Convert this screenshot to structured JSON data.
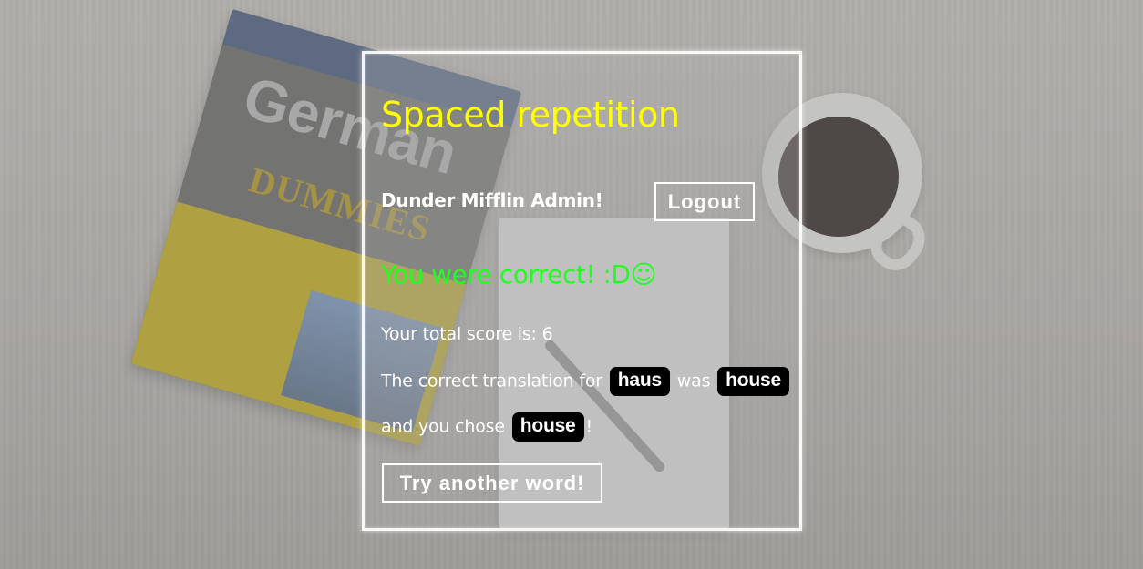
{
  "app": {
    "title": "Spaced repetition"
  },
  "header": {
    "user_greeting": "Dunder Mifflin Admin!",
    "logout_label": "Logout"
  },
  "result": {
    "feedback": "You were correct! :D☺",
    "score_line": "Your total score is: 6",
    "translation_prefix": "The correct translation for",
    "original_word": "haus",
    "was_text": "was",
    "correct_translation": "house",
    "chose_prefix": "and you chose",
    "user_guess": "house",
    "chose_suffix": "!"
  },
  "actions": {
    "next_label": "Try another word!"
  },
  "colors": {
    "title": "#ffff00",
    "feedback_correct": "#1fff1f",
    "pill_bg": "#000000",
    "text": "#ffffff"
  }
}
